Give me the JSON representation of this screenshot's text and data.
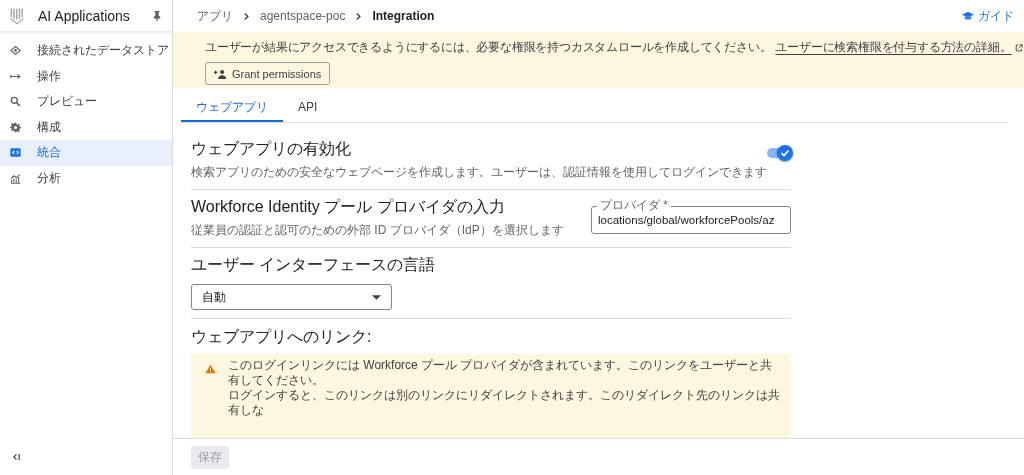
{
  "app": {
    "title": "AI Applications"
  },
  "sidebar": {
    "items": [
      {
        "label": "接続されたデータストア",
        "selected": false
      },
      {
        "label": "操作",
        "selected": false
      },
      {
        "label": "プレビュー",
        "selected": false
      },
      {
        "label": "構成",
        "selected": false
      },
      {
        "label": "統合",
        "selected": true
      },
      {
        "label": "分析",
        "selected": false
      }
    ]
  },
  "breadcrumb": [
    "アプリ",
    "agentspace-poc",
    "Integration"
  ],
  "guide_link": "ガイド",
  "banner": {
    "text": "ユーザーが結果にアクセスできるようにするには、必要な権限を持つカスタムロールを作成してください。",
    "link": "ユーザーに検索権限を付与する方法の詳細。",
    "button": "Grant permissions"
  },
  "tabs": [
    {
      "label": "ウェブアプリ",
      "selected": true
    },
    {
      "label": "API",
      "selected": false
    }
  ],
  "enable_section": {
    "title": "ウェブアプリの有効化",
    "description": "検索アプリのための安全なウェブページを作成します。ユーザーは、認証情報を使用してログインできます",
    "on": true
  },
  "idp_section": {
    "title": "Workforce Identity プール プロバイダの入力",
    "description": "従業員の認証と認可のための外部 ID プロバイダ（IdP）を選択します",
    "field": {
      "label": "プロバイダ *",
      "value": "locations/global/workforcePools/az"
    }
  },
  "language_section": {
    "title": "ユーザー インターフェースの言語",
    "select": {
      "value": "自動"
    }
  },
  "link_section": {
    "title": "ウェブアプリへのリンク:",
    "notice": {
      "lines": [
        "このログインリンクには Workforce プール プロバイダが含まれています。このリンクをユーザーと共有してください。",
        "ログインすると、このリンクは別のリンクにリダイレクトされます。このリダイレクト先のリンクは共有しな"
      ]
    }
  },
  "footer": {
    "save_button": {
      "label": "保存",
      "disabled": true
    }
  }
}
